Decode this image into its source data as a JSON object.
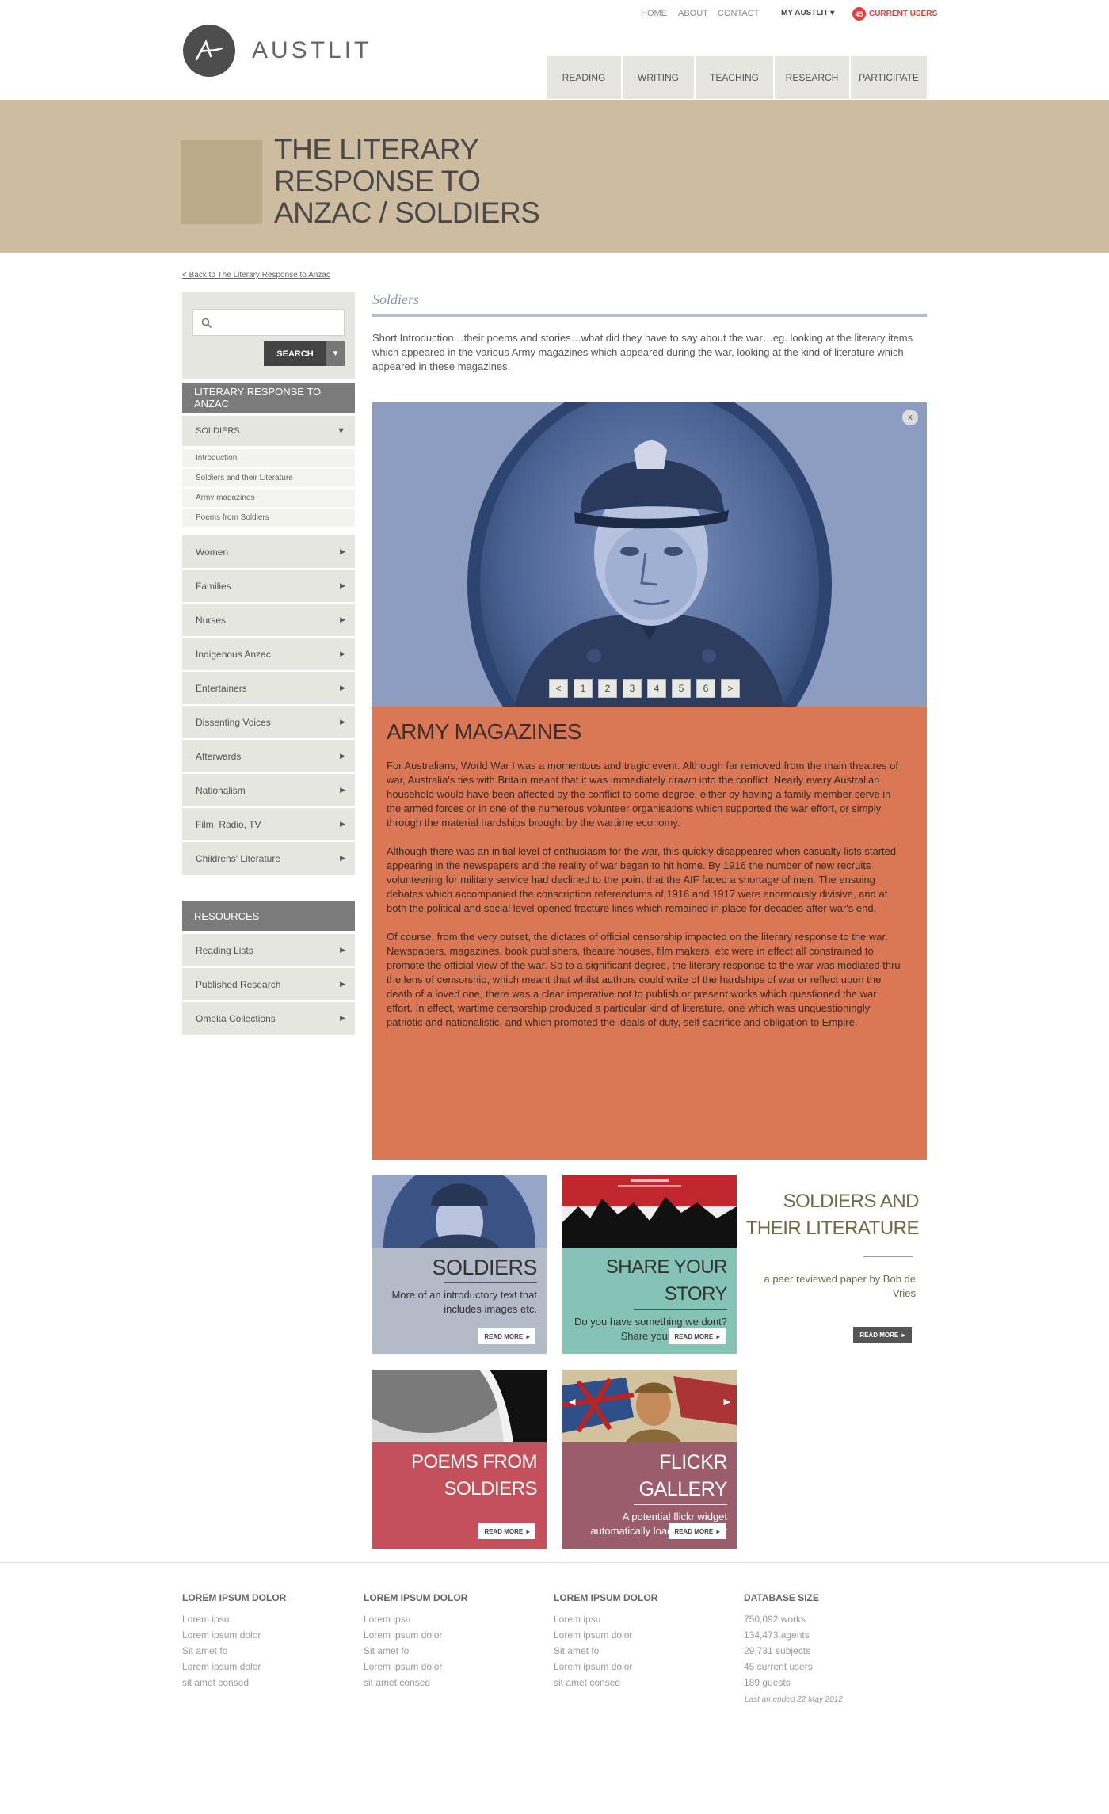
{
  "header": {
    "logo_text": "AUSTLIT",
    "top_links": [
      "HOME",
      "ABOUT",
      "CONTACT"
    ],
    "my_austlit": "MY AUSTLIT",
    "users_count": "45",
    "users_label": "CURRENT USERS",
    "nav": [
      "READING",
      "WRITING",
      "TEACHING",
      "RESEARCH",
      "PARTICIPATE"
    ]
  },
  "banner": {
    "title_lines": [
      "THE LITERARY",
      "RESPONSE TO",
      "ANZAC / SOLDIERS"
    ]
  },
  "sidebar": {
    "back_link": "< Back to The Literary Response to Anzac",
    "search_placeholder": "",
    "search_button": "SEARCH",
    "section_header": "LITERARY RESPONSE TO ANZAC",
    "active_item": "SOLDIERS",
    "sub_items": [
      "Introduction",
      "Soldiers and their Literature",
      "Army magazines",
      "Poems from Soldiers"
    ],
    "items": [
      "Women",
      "Families",
      "Nurses",
      "Indigenous Anzac",
      "Entertainers",
      "Dissenting Voices",
      "Afterwards",
      "Nationalism",
      "Film, Radio, TV",
      "Childrens' Literature"
    ],
    "resources_header": "RESOURCES",
    "resources": [
      "Reading Lists",
      "Published Research",
      "Omeka Collections"
    ]
  },
  "main": {
    "section_title": "Soldiers",
    "intro": "Short Introduction…their poems and stories…what did they have to say about the war…eg. looking at the literary items which appeared in the various Army magazines which appeared during the war, looking at the kind of literature which appeared in these magazines.",
    "hero_close": "x",
    "pagination": [
      "<",
      "1",
      "2",
      "3",
      "4",
      "5",
      "6",
      ">"
    ],
    "article_title": "ARMY MAGAZINES",
    "article_paragraphs": [
      "For Australians, World War I was a momentous and tragic event. Although far removed from the main theatres of war, Australia's ties with Britain meant that it was immediately drawn into the conflict. Nearly every Australian household would have been affected by the conflict to some degree, either by having a family member serve in the armed forces or in one of the numerous volunteer organisations which supported the war effort, or simply through the material hardships brought by the wartime economy.",
      "Although there was an initial level of enthusiasm for the war, this quickly disappeared when casualty lists started appearing in the newspapers and the reality of war began to hit home. By 1916 the number of new recruits volunteering for military service had declined to the point that the AIF faced a shortage of men. The ensuing debates which accompanied the conscription referendums of 1916 and 1917 were enormously divisive, and at both the political and social level opened fracture lines which remained in place for decades after war's end.",
      "Of course, from the very outset, the dictates of official censorship impacted on the literary response to the war. Newspapers, magazines, book publishers, theatre houses, film makers, etc were in effect all constrained to promote the official view of the war. So to a significant degree, the literary response to the war was mediated thru the lens of censorship, which meant that whilst authors could write of the hardships of war or reflect upon the death of a loved one, there was a clear imperative not to publish or present works which questioned the war effort. In effect, wartime censorship produced a particular kind of literature, one which was unquestioningly patriotic and nationalistic, and which promoted the ideals of duty, self-sacrifice and obligation to Empire."
    ]
  },
  "cards": [
    {
      "title": "SOLDIERS",
      "text": "More of an introductory text that includes images etc.",
      "read_more": "READ MORE",
      "color": "#b3bac8",
      "text_color": "#333"
    },
    {
      "title": "SHARE YOUR STORY",
      "text": "Do you have something we dont? Share your experience.",
      "read_more": "READ MORE",
      "color": "#86c3b7",
      "text_color": "#333"
    },
    {
      "title": "POEMS FROM SOLDIERS",
      "text": "",
      "read_more": "READ MORE",
      "color": "#c4505c",
      "text_color": "#fff"
    },
    {
      "title": "FLICKR GALLERY",
      "text": "A potential flickr widget automatically loads a flickr set",
      "read_more": "READ MORE",
      "color": "#9b5d6b",
      "text_color": "#fff"
    }
  ],
  "feature": {
    "title": "SOLDIERS AND THEIR LITERATURE",
    "desc": "a peer reviewed paper by Bob de Vries",
    "button": "READ MORE"
  },
  "footer": {
    "columns": [
      {
        "heading": "LOREM IPSUM DOLOR",
        "lines": [
          "Lorem ipsu",
          "Lorem ipsum dolor",
          "Sit amet fo",
          "Lorem ipsum dolor",
          "sit amet consed"
        ]
      },
      {
        "heading": "LOREM IPSUM DOLOR",
        "lines": [
          "Lorem ipsu",
          "Lorem ipsum dolor",
          "Sit amet fo",
          "Lorem ipsum dolor",
          "sit amet consed"
        ]
      },
      {
        "heading": "LOREM IPSUM DOLOR",
        "lines": [
          "Lorem ipsu",
          "Lorem ipsum dolor",
          "Sit amet fo",
          "Lorem ipsum dolor",
          "sit amet consed"
        ]
      },
      {
        "heading": "DATABASE SIZE",
        "lines": [
          "750,092 works",
          "134,473 agents",
          "29,731 subjects",
          "45 current users",
          "189 guests"
        ]
      }
    ],
    "amended": "Last amended  22 May 2012"
  }
}
